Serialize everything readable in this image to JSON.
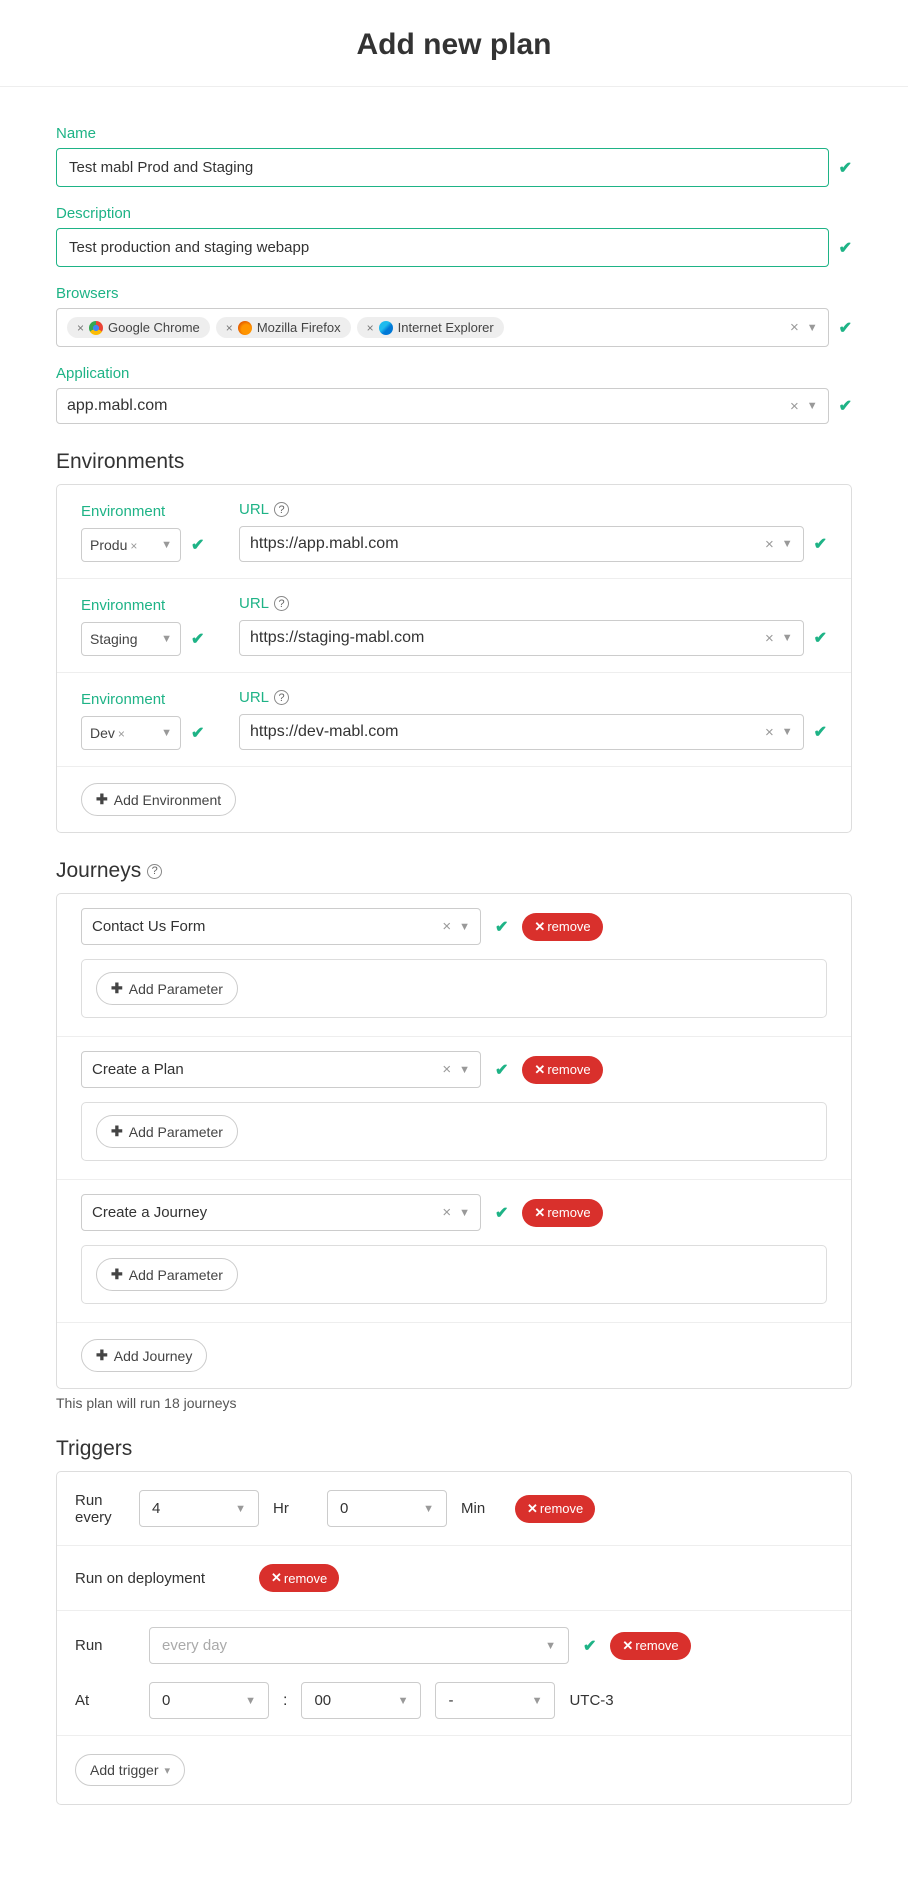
{
  "title": "Add new plan",
  "labels": {
    "name": "Name",
    "description": "Description",
    "browsers": "Browsers",
    "application": "Application",
    "environments": "Environments",
    "environment": "Environment",
    "url": "URL",
    "journeys": "Journeys",
    "triggers": "Triggers",
    "run_every": "Run every",
    "hr": "Hr",
    "min": "Min",
    "run_on_deployment": "Run on deployment",
    "run": "Run",
    "at": "At"
  },
  "name_value": "Test mabl Prod and Staging",
  "description_value": "Test production and staging webapp",
  "browsers_chips": [
    {
      "label": "Google Chrome",
      "icon": "chrome"
    },
    {
      "label": "Mozilla Firefox",
      "icon": "firefox"
    },
    {
      "label": "Internet Explorer",
      "icon": "ie"
    }
  ],
  "application_value": "app.mabl.com",
  "environments": [
    {
      "env": "Produ",
      "env_clear": true,
      "url": "https://app.mabl.com"
    },
    {
      "env": "Staging",
      "env_clear": false,
      "url": "https://staging-mabl.com"
    },
    {
      "env": "Dev",
      "env_clear": true,
      "url": "https://dev-mabl.com"
    }
  ],
  "buttons": {
    "add_environment": "Add Environment",
    "add_parameter": "Add Parameter",
    "add_journey": "Add Journey",
    "remove": "remove",
    "add_trigger": "Add trigger"
  },
  "journeys": [
    {
      "name": "Contact Us Form"
    },
    {
      "name": "Create a Plan"
    },
    {
      "name": "Create a Journey"
    }
  ],
  "journeys_note": "This plan will run 18 journeys",
  "triggers": {
    "run_every_hr": "4",
    "run_every_min": "0",
    "run_schedule": "every day",
    "at_hr": "0",
    "at_min": "00",
    "at_ampm": "-",
    "tz": "UTC-3"
  }
}
